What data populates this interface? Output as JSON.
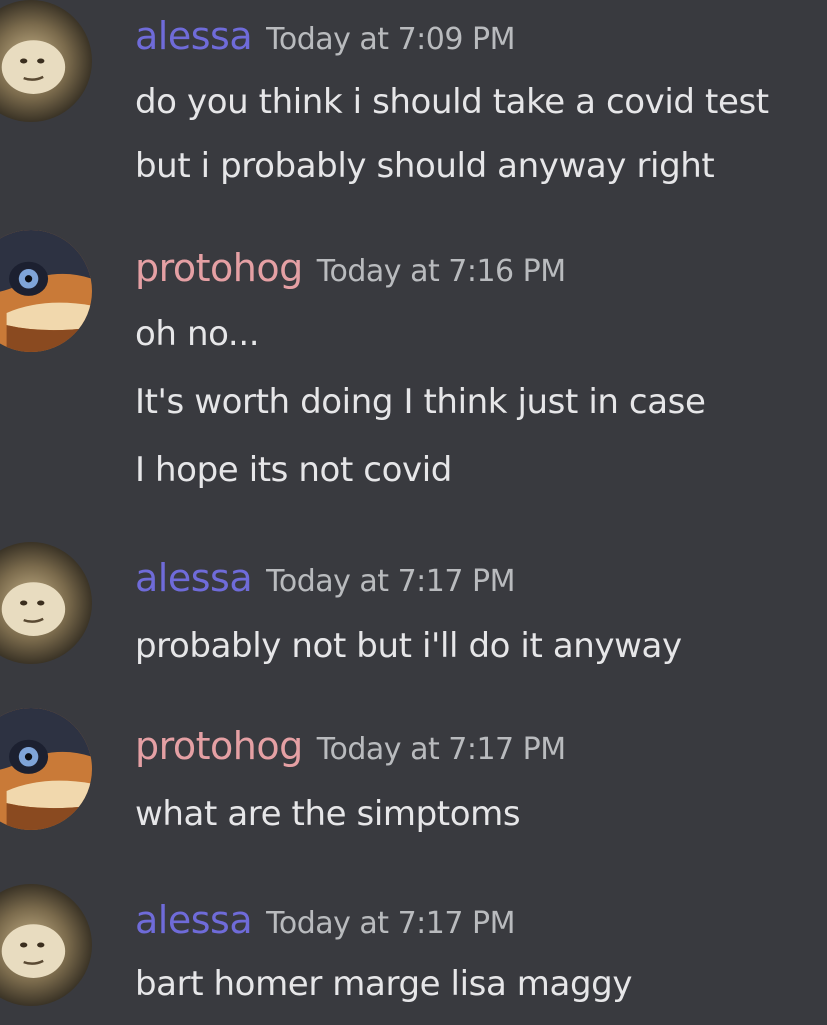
{
  "colors": {
    "background": "#393a3f",
    "alessa_name": "#6f6bd9",
    "protohog_name": "#e5a0a4",
    "timestamp": "#b9bbbe",
    "message_text": "#e6e6e8"
  },
  "messages": [
    {
      "author": "alessa",
      "avatar_icon": "monkey-avatar-icon",
      "timestamp": "Today at 7:09 PM",
      "lines": [
        "do you think i should take a covid test",
        "but i probably should anyway right"
      ]
    },
    {
      "author": "protohog",
      "avatar_icon": "bird-avatar-icon",
      "timestamp": "Today at 7:16 PM",
      "lines": [
        "oh no...",
        "It's worth doing I think just in case",
        "I hope its not covid"
      ]
    },
    {
      "author": "alessa",
      "avatar_icon": "monkey-avatar-icon",
      "timestamp": "Today at 7:17 PM",
      "lines": [
        "probably not but i'll do it anyway"
      ]
    },
    {
      "author": "protohog",
      "avatar_icon": "bird-avatar-icon",
      "timestamp": "Today at 7:17 PM",
      "lines": [
        "what are the simptoms"
      ]
    },
    {
      "author": "alessa",
      "avatar_icon": "monkey-avatar-icon",
      "timestamp": "Today at 7:17 PM",
      "lines": [
        "bart homer marge lisa maggy"
      ]
    }
  ]
}
